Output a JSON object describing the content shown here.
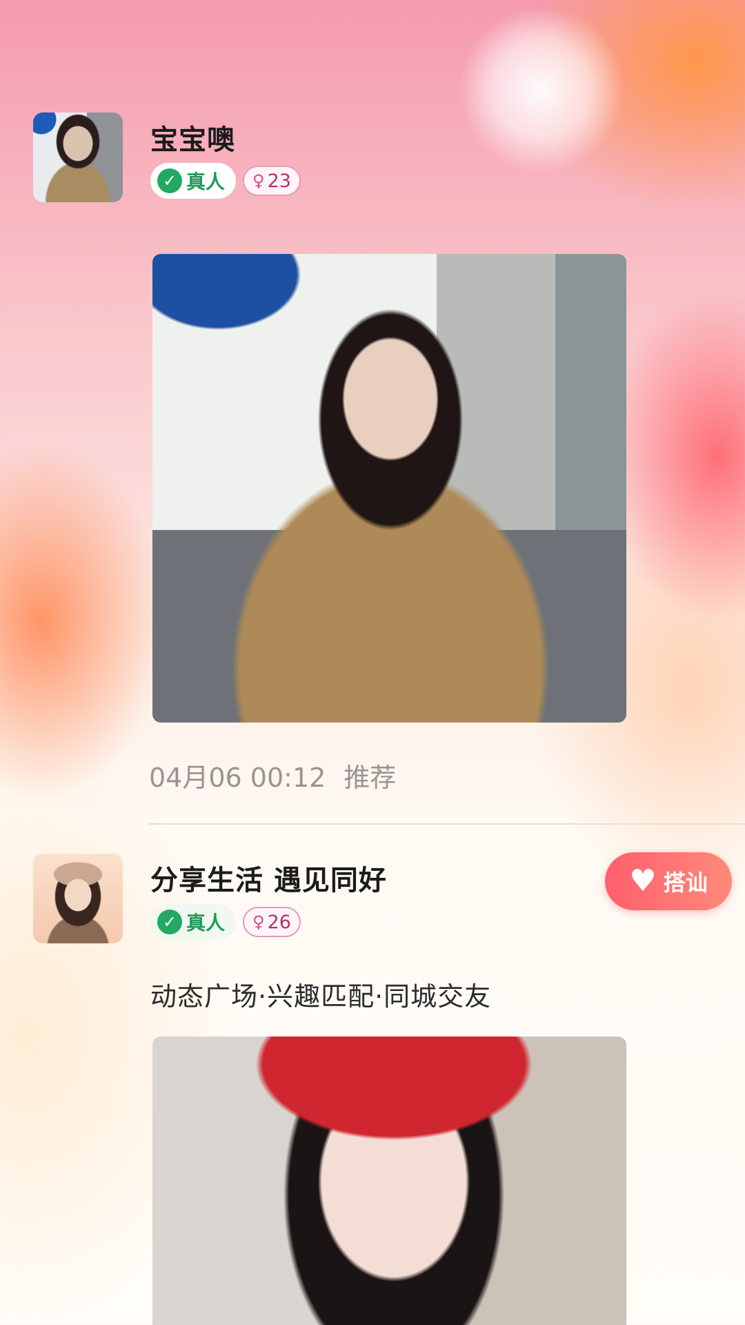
{
  "posts": [
    {
      "username": "宝宝噢",
      "badge_real": "真人",
      "age": "23",
      "timestamp": "04月06 00:12",
      "tag": "推荐"
    },
    {
      "username": "分享生活 遇见同好",
      "badge_real": "真人",
      "age": "26",
      "chat_button": "搭讪",
      "description": "动态广场·兴趣匹配·同城交友"
    }
  ],
  "icons": {
    "check": "check-circle-icon",
    "female": "female-icon",
    "heart": "heart-icon"
  },
  "colors": {
    "badge_real": "#22a861",
    "badge_age": "#b8326a",
    "chat_button": "#ff5f6d"
  }
}
